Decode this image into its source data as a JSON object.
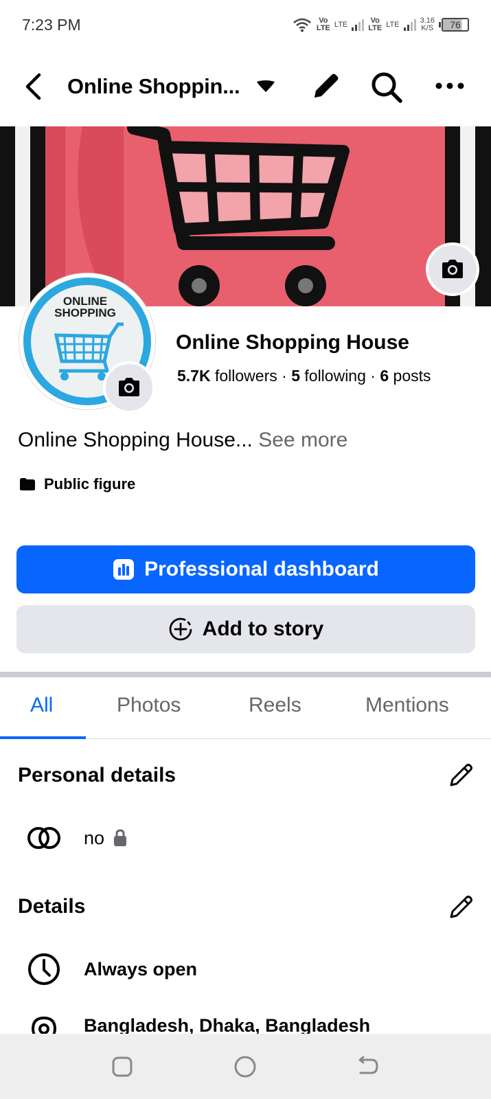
{
  "status_bar": {
    "time": "7:23 PM",
    "sim1_top": "Vo",
    "sim1_bottom": "LTE",
    "sim1_net": "LTE",
    "sim2_top": "Vo",
    "sim2_bottom": "LTE",
    "sim2_net": "LTE",
    "speed_value": "3.16",
    "speed_unit": "K/S",
    "battery": "76"
  },
  "header": {
    "title": "Online Shoppin..."
  },
  "profile": {
    "avatar_line1": "ONLINE",
    "avatar_line2": "SHOPPING",
    "name": "Online Shopping House",
    "followers_count": "5.7K",
    "followers_label": "followers",
    "following_count": "5",
    "following_label": "following",
    "posts_count": "6",
    "posts_label": "posts",
    "separator": "·",
    "bio": "Online Shopping House...",
    "see_more": "See more",
    "category": "Public figure"
  },
  "buttons": {
    "dashboard": "Professional dashboard",
    "add_story": "Add to story"
  },
  "tabs": [
    "All",
    "Photos",
    "Reels",
    "Mentions"
  ],
  "personal_details": {
    "title": "Personal details",
    "relationship": "no"
  },
  "details": {
    "title": "Details",
    "hours": "Always open",
    "location": "Bangladesh, Dhaka, Bangladesh"
  },
  "colors": {
    "accent": "#0866ff",
    "cover": "#e8606d",
    "avatar_ring": "#2aa8df"
  }
}
